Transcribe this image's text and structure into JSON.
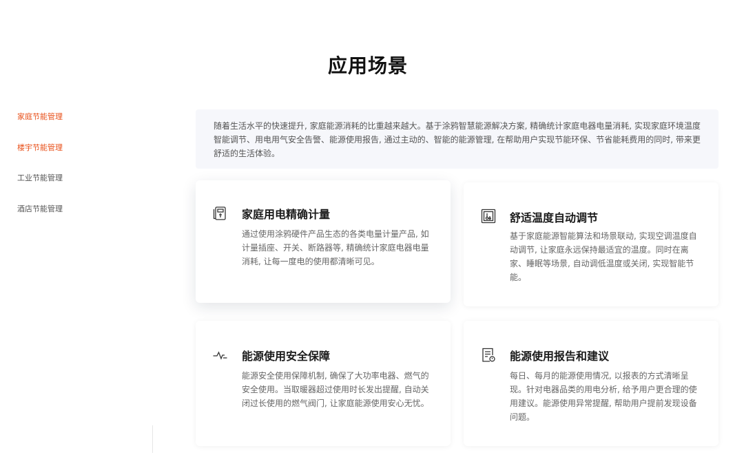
{
  "section_title": "应用场景",
  "side_nav": {
    "items": [
      {
        "label": "家庭节能管理",
        "active": true
      },
      {
        "label": "楼宇节能管理",
        "active": true
      },
      {
        "label": "工业节能管理",
        "active": false
      },
      {
        "label": "酒店节能管理",
        "active": false
      }
    ]
  },
  "intro": {
    "text": "随着生活水平的快速提升, 家庭能源消耗的比重越来越大。基于涂鸦智慧能源解决方案, 精确统计家庭电器电量消耗, 实现家庭环境温度智能调节、用电用气安全告警、能源使用报告, 通过主动的、智能的能源管理, 在帮助用户实现节能环保、节省能耗费用的同时, 带来更舒适的生活体验。"
  },
  "cards": [
    {
      "icon": "meter-icon",
      "title": "家庭用电精确计量",
      "desc": "通过使用涂鸦硬件产品生态的各类电量计量产品, 如计量插座、开关、断路器等, 精确统计家庭电器电量消耗, 让每一度电的使用都清晰可见。"
    },
    {
      "icon": "temperature-icon",
      "title": "舒适温度自动调节",
      "desc": "基于家庭能源智能算法和场景联动, 实现空调温度自动调节, 让家庭永远保持最适宜的温度。同时在离家、睡眠等场景, 自动调低温度或关闭, 实现智能节能。"
    },
    {
      "icon": "pulse-icon",
      "title": "能源使用安全保障",
      "desc": "能源安全使用保障机制, 确保了大功率电器、燃气的安全使用。当取暖器超过使用时长发出提醒, 自动关闭过长使用的燃气阀门, 让家庭能源使用安心无忧。"
    },
    {
      "icon": "report-icon",
      "title": "能源使用报告和建议",
      "desc": "每日、每月的能源使用情况, 以报表的方式清晰呈现。针对电器品类的用电分析, 给予用户更合理的使用建议。能源使用异常提醒, 帮助用户提前发现设备问题。"
    }
  ],
  "colors": {
    "accent": "#e8501a",
    "intro_bg": "#f6f7fb",
    "title": "#111111",
    "text": "#666666"
  }
}
